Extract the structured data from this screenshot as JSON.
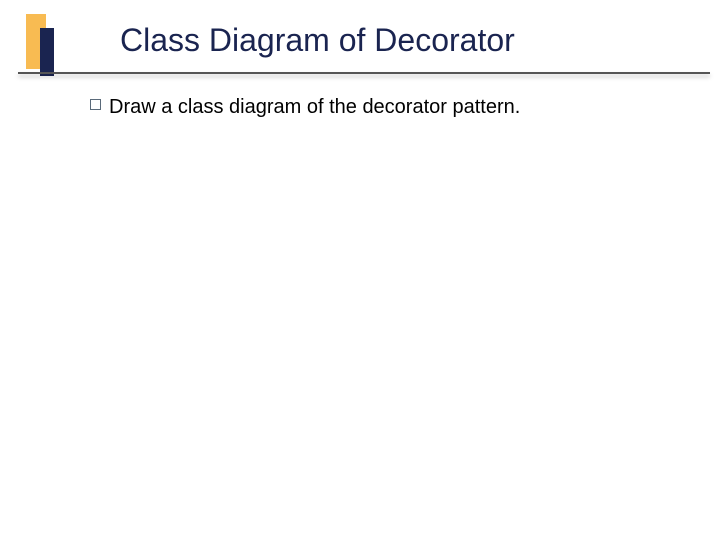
{
  "slide": {
    "title": "Class Diagram of Decorator",
    "bullets": [
      {
        "text": "Draw a class diagram of the decorator pattern."
      }
    ]
  }
}
